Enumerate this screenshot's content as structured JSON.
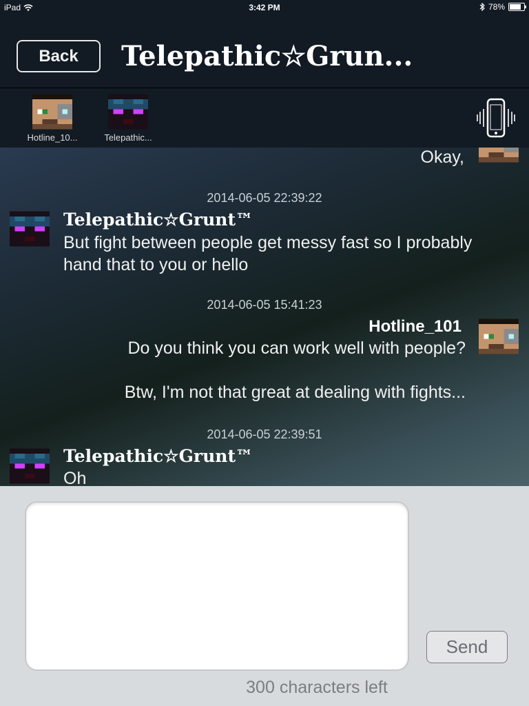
{
  "status_bar": {
    "device": "iPad",
    "time": "3:42 PM",
    "battery": "78%"
  },
  "header": {
    "back_label": "Back",
    "title": "Telepathic☆Grun..."
  },
  "members": [
    {
      "name": "Hotline_10..."
    },
    {
      "name": "Telepathic..."
    }
  ],
  "icons": {
    "vibrate": "phone-vibrate-icon",
    "wifi": "wifi-icon",
    "bluetooth": "bluetooth-icon",
    "battery": "battery-icon"
  },
  "messages": [
    {
      "sender": "Hotline_101",
      "side": "right",
      "text": "Okay,"
    },
    {
      "timestamp": "2014-06-05 22:39:22",
      "sender": "Telepathic☆Grunt™",
      "side": "left",
      "text": "But fight between people get messy fast so I probably hand that to you or hello"
    },
    {
      "timestamp": "2014-06-05 15:41:23",
      "sender": "Hotline_101",
      "side": "right",
      "text": "Do you think you can work well with people?\n\nBtw, I'm not that great at dealing with fights..."
    },
    {
      "timestamp": "2014-06-05 22:39:51",
      "sender": "Telepathic☆Grunt™",
      "side": "left",
      "text": "Oh"
    }
  ],
  "composer": {
    "input_value": "",
    "send_label": "Send",
    "counter": "300 characters left"
  },
  "colors": {
    "bar_bg": "#121a24",
    "composer_bg": "#d8dbde",
    "text_white": "#ffffff"
  }
}
